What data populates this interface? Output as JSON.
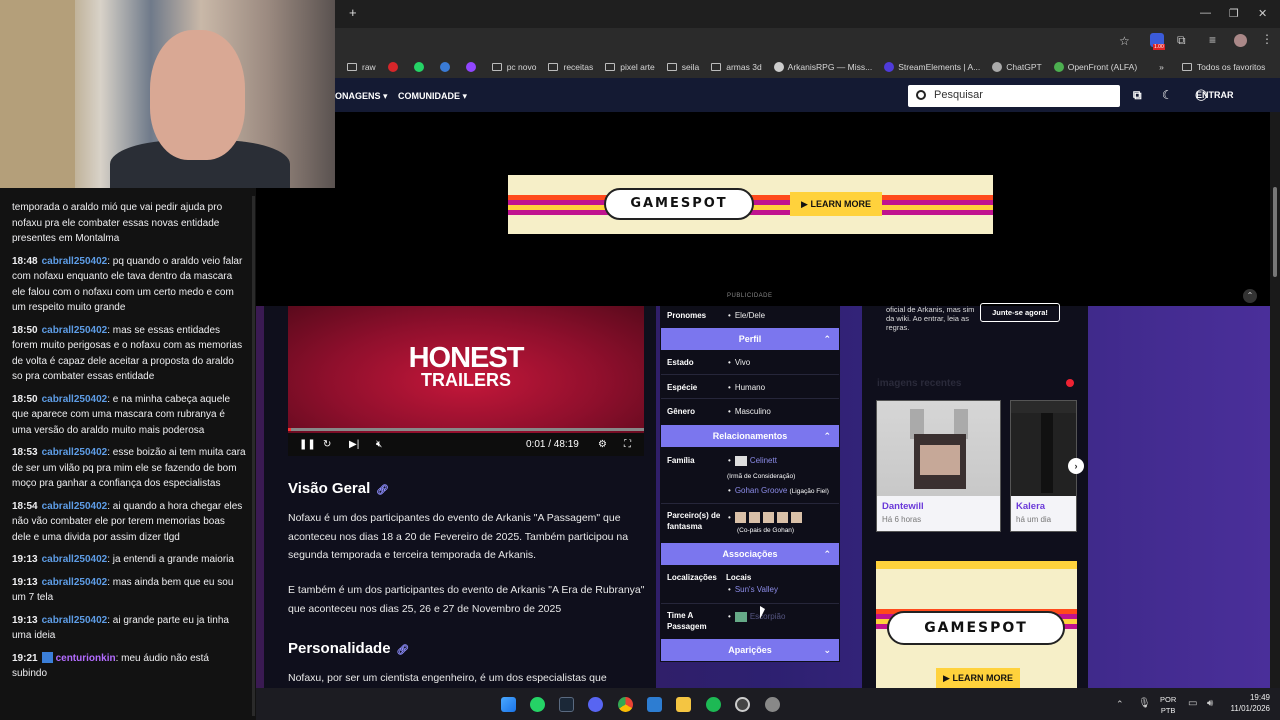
{
  "browser": {
    "new_tab": "+",
    "bookmarks": [
      {
        "label": "raw",
        "kind": "folder"
      },
      {
        "label": "",
        "kind": "dot",
        "color": "#d6262a"
      },
      {
        "label": "",
        "kind": "dot",
        "color": "#25d366"
      },
      {
        "label": "",
        "kind": "dot",
        "color": "#3a7bd5"
      },
      {
        "label": "",
        "kind": "dot",
        "color": "#9146ff"
      },
      {
        "label": "pc novo",
        "kind": "folder"
      },
      {
        "label": "receitas",
        "kind": "folder"
      },
      {
        "label": "pixel arte",
        "kind": "folder"
      },
      {
        "label": "seila",
        "kind": "folder"
      },
      {
        "label": "armas 3d",
        "kind": "folder"
      },
      {
        "label": "ArkanisRPG — Miss...",
        "kind": "dot",
        "color": "#cccccc"
      },
      {
        "label": "StreamElements | A...",
        "kind": "dot",
        "color": "#4f3bd9"
      },
      {
        "label": "ChatGPT",
        "kind": "dot",
        "color": "#aaaaaa"
      },
      {
        "label": "OpenFront (ALFA)",
        "kind": "dot",
        "color": "#4caf50"
      }
    ],
    "bookmarks_more": "»",
    "all_favorites": "Todos os favoritos",
    "ext_badge": "1.00"
  },
  "chat": {
    "messages": [
      {
        "time": "",
        "user": "",
        "text": "temporada o araldo mió que vai pedir ajuda pro nofaxu pra ele combater essas novas entidade presentes em Montalma"
      },
      {
        "time": "18:48",
        "user": "cabrall250402",
        "text": ": pq quando o araldo veio falar com nofaxu enquanto ele tava dentro da mascara ele falou com o nofaxu com um certo medo e com um respeito muito grande"
      },
      {
        "time": "18:50",
        "user": "cabrall250402",
        "text": ": mas se essas entidades forem muito perigosas e o nofaxu com as memorias de volta é capaz dele aceitar a proposta do araldo so pra combater essas entidade"
      },
      {
        "time": "18:50",
        "user": "cabrall250402",
        "text": ": e na minha cabeça aquele que aparece com uma mascara com rubranya é uma versão do araldo muito mais poderosa"
      },
      {
        "time": "18:53",
        "user": "cabrall250402",
        "text": ": esse boizão ai tem muita cara de ser um vilão pq pra mim ele se fazendo de bom moço pra ganhar a confiança dos especialistas"
      },
      {
        "time": "18:54",
        "user": "cabrall250402",
        "text": ": ai quando a hora chegar eles não vão combater ele por terem memorias boas dele e uma divida por assim dizer tlgd"
      },
      {
        "time": "19:13",
        "user": "cabrall250402",
        "text": ": ja entendi a grande maioria"
      },
      {
        "time": "19:13",
        "user": "cabrall250402",
        "text": ": mas ainda bem que eu sou um 7 tela"
      },
      {
        "time": "19:13",
        "user": "cabrall250402",
        "text": ": ai grande parte eu ja tinha uma ideia"
      },
      {
        "time": "19:21",
        "user": "centurionkin",
        "text": ": meu áudio não está subindo",
        "purple": true
      }
    ]
  },
  "site_nav": {
    "items": [
      "ONAGENS ▾",
      "COMUNIDADE ▾"
    ],
    "search_placeholder": "Pesquisar",
    "login": "ENTRAR"
  },
  "ads": {
    "brand": "GAMESPOT",
    "cta": "▶ LEARN MORE",
    "label": "PUBLICIDADE"
  },
  "video": {
    "line1": "HONEST",
    "line2": "TRAILERS",
    "time": "0:01 / 48:19",
    "progress": 0.0
  },
  "article": {
    "heading1": "Visão Geral",
    "para1": "Nofaxu é um dos participantes do evento de Arkanis \"A Passagem\" que aconteceu nos dias 18 a 20 de Fevereiro de 2025. Também participou na segunda temporada e terceira temporada de Arkanis.",
    "para2": "E também é um dos participantes do evento de Arkanis \"A Era de Rubranya\" que aconteceu nos dias 25, 26 e 27 de Novembro de 2025",
    "heading2": "Personalidade",
    "para3": "Nofaxu, por ser um cientista engenheiro, é um dos especialistas que"
  },
  "infobox": {
    "pronomes_label": "Pronomes",
    "pronomes_val": "Ele/Dele",
    "perfil": "Perfil",
    "estado_label": "Estado",
    "estado_val": "Vivo",
    "especie_label": "Espécie",
    "especie_val": "Humano",
    "genero_label": "Gênero",
    "genero_val": "Masculino",
    "relacionamentos": "Relacionamentos",
    "familia_label": "Família",
    "familia_1": "Celinett",
    "familia_1_sub": "(Irmã de Consideração)",
    "familia_2": "Gohan Groove",
    "familia_2_sub": "(Ligação Fiel)",
    "parceiros_label": "Parceiro(s) de fantasma",
    "parceiros_sub": "(Co-pais de Gohan)",
    "associacoes": "Associações",
    "local_label": "Localizações",
    "local_head": "Locais",
    "local_val": "Sun's Valley",
    "time_label": "Time A Passagem",
    "time_val": "Escorpião",
    "aparicoes": "Aparições"
  },
  "right": {
    "join_text": "oficial de Arkanis, mas sim da wiki. Ao entrar, leia as regras.",
    "join_btn": "Junte-se agora!",
    "recent_title": "imagens recentes",
    "cards": [
      {
        "name": "Dantewill",
        "when": "Há 6 horas"
      },
      {
        "name": "Kalera",
        "when": "há um dia"
      }
    ]
  },
  "taskbar": {
    "lang1": "POR",
    "lang2": "PTB",
    "time": "19:49",
    "date": "11/01/2026"
  }
}
